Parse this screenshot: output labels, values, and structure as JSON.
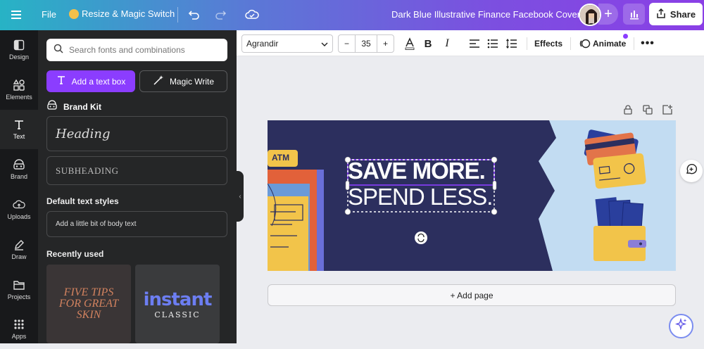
{
  "topbar": {
    "file_label": "File",
    "resize_label": "Resize & Magic Switch",
    "doc_title": "Dark Blue Illustrative Finance Facebook Cover",
    "share_label": "Share"
  },
  "rail": {
    "items": [
      {
        "label": "Design",
        "icon": "layout-icon"
      },
      {
        "label": "Elements",
        "icon": "shapes-icon"
      },
      {
        "label": "Text",
        "icon": "text-icon"
      },
      {
        "label": "Brand",
        "icon": "brand-icon"
      },
      {
        "label": "Uploads",
        "icon": "cloud-upload-icon"
      },
      {
        "label": "Draw",
        "icon": "pen-icon"
      },
      {
        "label": "Projects",
        "icon": "folder-icon"
      },
      {
        "label": "Apps",
        "icon": "grid-icon"
      }
    ]
  },
  "panel": {
    "search_placeholder": "Search fonts and combinations",
    "add_textbox_label": "Add a text box",
    "magic_write_label": "Magic Write",
    "brand_kit_label": "Brand Kit",
    "heading_sample": "Heading",
    "subheading_sample": "SUBHEADING",
    "default_styles_label": "Default text styles",
    "body_sample": "Add a little bit of body text",
    "recently_used_label": "Recently used",
    "recent": [
      {
        "lines": [
          "FIVE TIPS",
          "FOR GREAT",
          "SKIN"
        ]
      },
      {
        "title": "instant",
        "subtitle": "CLASSIC"
      }
    ]
  },
  "toolbar": {
    "font_name": "Agrandir",
    "minus": "−",
    "font_size": "35",
    "plus": "+",
    "effects_label": "Effects",
    "animate_label": "Animate"
  },
  "design": {
    "line1": "SAVE MORE.",
    "line2": "SPEND LESS.",
    "atm_label": "ATM"
  },
  "add_page_label": "+ Add page"
}
